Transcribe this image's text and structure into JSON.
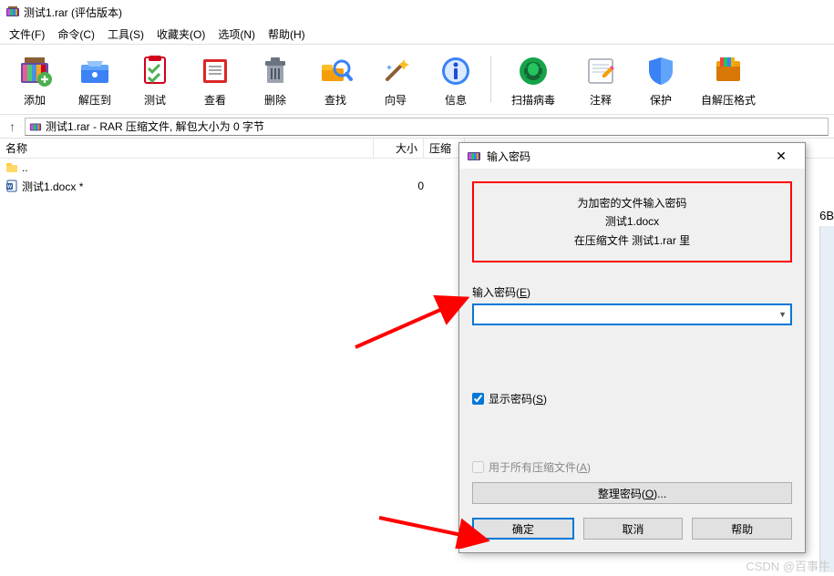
{
  "title": "测试1.rar (评估版本)",
  "menus": [
    "文件(F)",
    "命令(C)",
    "工具(S)",
    "收藏夹(O)",
    "选项(N)",
    "帮助(H)"
  ],
  "toolbar": [
    {
      "label": "添加",
      "icon": "add"
    },
    {
      "label": "解压到",
      "icon": "extract"
    },
    {
      "label": "测试",
      "icon": "test"
    },
    {
      "label": "查看",
      "icon": "view"
    },
    {
      "label": "删除",
      "icon": "delete"
    },
    {
      "label": "查找",
      "icon": "find"
    },
    {
      "label": "向导",
      "icon": "wizard"
    },
    {
      "label": "信息",
      "icon": "info"
    },
    {
      "label": "扫描病毒",
      "icon": "scan",
      "wide": true
    },
    {
      "label": "注释",
      "icon": "comment"
    },
    {
      "label": "保护",
      "icon": "protect"
    },
    {
      "label": "自解压格式",
      "icon": "sfx",
      "wide": true
    }
  ],
  "path_text": "测试1.rar - RAR 压缩文件, 解包大小为 0 字节",
  "columns": {
    "name": "名称",
    "size": "大小",
    "packed": "压缩"
  },
  "files": [
    {
      "name": "..",
      "type": "folder",
      "size": ""
    },
    {
      "name": "测试1.docx *",
      "type": "docx",
      "size": "0"
    }
  ],
  "right_text": "6B",
  "dialog": {
    "title": "输入密码",
    "hl_line1": "为加密的文件输入密码",
    "hl_line2": "测试1.docx",
    "hl_line3": "在压缩文件 测试1.rar 里",
    "field_label_pre": "输入密码(",
    "field_label_u": "E",
    "field_label_post": ")",
    "show_pw_pre": "显示密码(",
    "show_pw_u": "S",
    "show_pw_post": ")",
    "all_files_pre": "用于所有压缩文件(",
    "all_files_u": "A",
    "all_files_post": ")",
    "organize_pre": "整理密码(",
    "organize_u": "O",
    "organize_post": ")...",
    "ok": "确定",
    "cancel": "取消",
    "help": "帮助"
  },
  "watermark": "CSDN @百事牛"
}
